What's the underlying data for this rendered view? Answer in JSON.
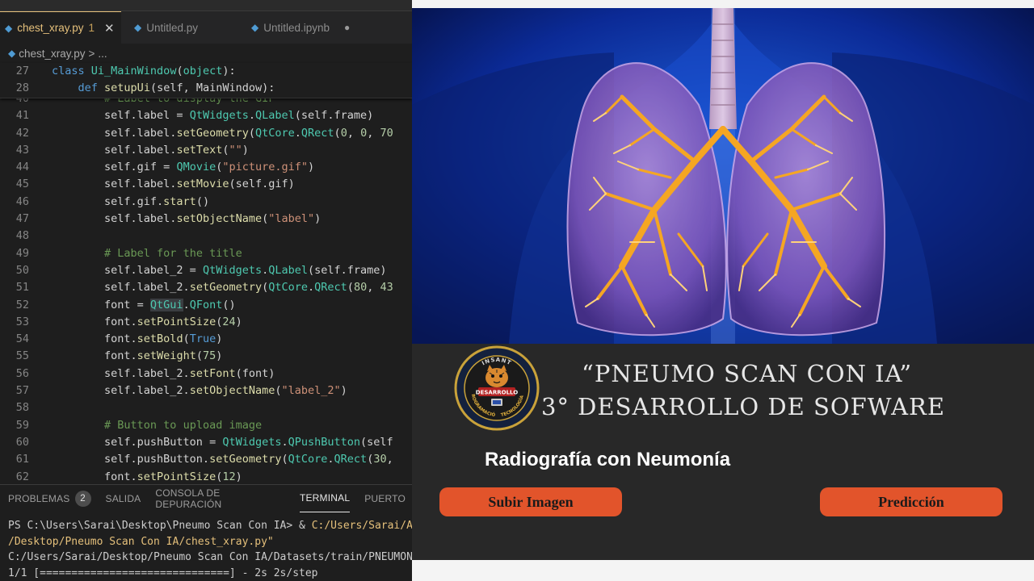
{
  "editor": {
    "tabs": [
      {
        "label": "chest_xray.py",
        "badge": "1",
        "active": true
      },
      {
        "label": "Untitled.py",
        "active": false
      },
      {
        "label": "Untitled.ipynb",
        "active": false
      }
    ],
    "breadcrumb": {
      "file": "chest_xray.py",
      "separator": ">",
      "rest": "..."
    },
    "sticky_lines": [
      {
        "n": "27",
        "html": "<span class='kw'>class</span> <span class='cls'>Ui_MainWindow</span>(<span class='cls'>object</span>):"
      },
      {
        "n": "28",
        "html": "    <span class='kw'>def</span> <span class='fn'>setupUi</span>(self, MainWindow):"
      }
    ],
    "lines": [
      {
        "n": "40",
        "html": "        <span class='cm'># Label to display the GIF</span>"
      },
      {
        "n": "41",
        "html": "        self.label = <span class='cls'>QtWidgets</span>.<span class='cls'>QLabel</span>(self.frame)"
      },
      {
        "n": "42",
        "html": "        self.label.<span class='fn'>setGeometry</span>(<span class='cls'>QtCore</span>.<span class='cls'>QRect</span>(<span class='num'>0</span>, <span class='num'>0</span>, <span class='num'>70</span>"
      },
      {
        "n": "43",
        "html": "        self.label.<span class='fn'>setText</span>(<span class='str'>\"\"</span>)"
      },
      {
        "n": "44",
        "html": "        self.gif = <span class='cls'>QMovie</span>(<span class='str'>\"picture.gif\"</span>)"
      },
      {
        "n": "45",
        "html": "        self.label.<span class='fn'>setMovie</span>(self.gif)"
      },
      {
        "n": "46",
        "html": "        self.gif.<span class='fn'>start</span>()"
      },
      {
        "n": "47",
        "html": "        self.label.<span class='fn'>setObjectName</span>(<span class='str'>\"label\"</span>)"
      },
      {
        "n": "48",
        "html": ""
      },
      {
        "n": "49",
        "html": "        <span class='cm'># Label for the title</span>"
      },
      {
        "n": "50",
        "html": "        self.label_2 = <span class='cls'>QtWidgets</span>.<span class='cls'>QLabel</span>(self.frame)"
      },
      {
        "n": "51",
        "html": "        self.label_2.<span class='fn'>setGeometry</span>(<span class='cls'>QtCore</span>.<span class='cls'>QRect</span>(<span class='num'>80</span>, <span class='num'>43</span>"
      },
      {
        "n": "52",
        "html": "        font = <span class='cls hl'>QtGui</span>.<span class='cls'>QFont</span>()"
      },
      {
        "n": "53",
        "html": "        font.<span class='fn'>setPointSize</span>(<span class='num'>24</span>)"
      },
      {
        "n": "54",
        "html": "        font.<span class='fn'>setBold</span>(<span class='kw'>True</span>)"
      },
      {
        "n": "55",
        "html": "        font.<span class='fn'>setWeight</span>(<span class='num'>75</span>)"
      },
      {
        "n": "56",
        "html": "        self.label_2.<span class='fn'>setFont</span>(font)"
      },
      {
        "n": "57",
        "html": "        self.label_2.<span class='fn'>setObjectName</span>(<span class='str'>\"label_2\"</span>)"
      },
      {
        "n": "58",
        "html": ""
      },
      {
        "n": "59",
        "html": "        <span class='cm'># Button to upload image</span>"
      },
      {
        "n": "60",
        "html": "        self.pushButton = <span class='cls'>QtWidgets</span>.<span class='cls'>QPushButton</span>(self"
      },
      {
        "n": "61",
        "html": "        self.pushButton.<span class='fn'>setGeometry</span>(<span class='cls'>QtCore</span>.<span class='cls'>QRect</span>(<span class='num'>30</span>,"
      },
      {
        "n": "62",
        "html": "        font.<span class='fn'>setPointSize</span>(<span class='num'>12</span>)"
      }
    ],
    "panel_tabs": [
      {
        "label": "PROBLEMAS",
        "badge": "2",
        "active": false
      },
      {
        "label": "SALIDA",
        "active": false
      },
      {
        "label": "CONSOLA DE DEPURACIÓN",
        "active": false
      },
      {
        "label": "TERMINAL",
        "active": true
      },
      {
        "label": "PUERTO",
        "active": false
      }
    ],
    "terminal_lines": [
      {
        "prefix": "PS C:\\Users\\Sarai\\Desktop\\Pneumo Scan Con IA> & ",
        "path": "C:/Users/Sarai/A"
      },
      {
        "prefix": "",
        "path": "/Desktop/Pneumo Scan Con IA/chest_xray.py\""
      },
      {
        "prefix": "C:/Users/Sarai/Desktop/Pneumo Scan Con IA/Datasets/train/PNEUMON",
        "path": ""
      },
      {
        "prefix": "1/1 [==============================] - 2s 2s/step",
        "path": ""
      }
    ]
  },
  "app": {
    "logo": {
      "top_text": "INSANT",
      "center_text": "DESARROLLO",
      "left_ring_text": "PROGRAMACIÓN",
      "right_ring_text": "TECNOLOGÍA"
    },
    "title_line1": "“PNEUMO SCAN CON IA”",
    "title_line2": "3° DESARROLLO DE SOFWARE",
    "subtitle": "Radiografía con Neumonía",
    "upload_button": "Subir Imagen",
    "predict_button": "Predicción"
  },
  "colors": {
    "accent_orange": "#e2542b",
    "panel_dark": "#282828",
    "editor_bg": "#1e1e1e",
    "image_blue": "#0a1e78"
  }
}
